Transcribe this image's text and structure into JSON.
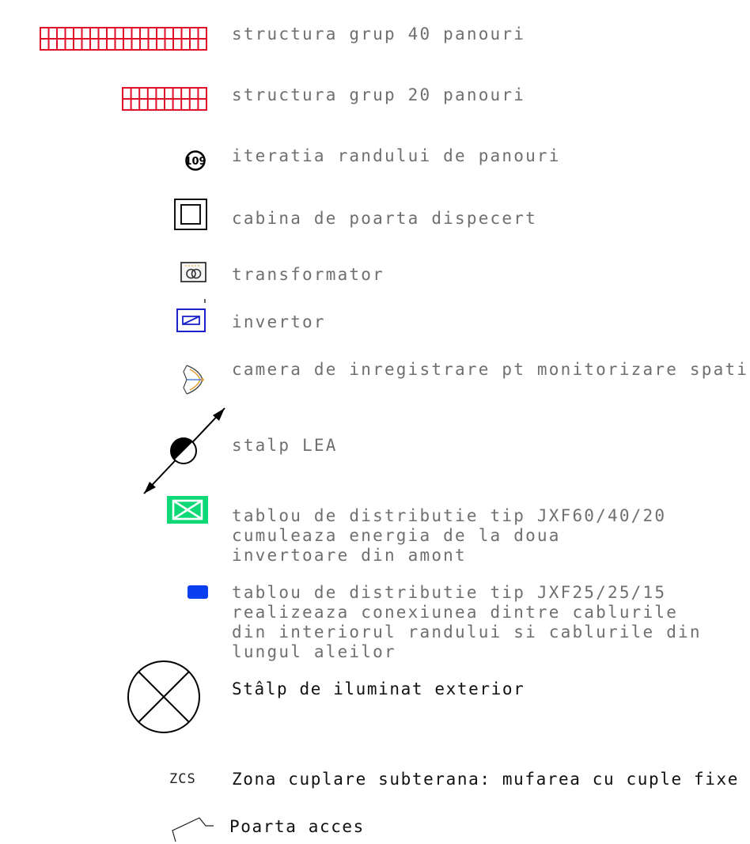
{
  "legend": {
    "struct40": "structura grup 40 panouri",
    "struct20": "structura grup 20 panouri",
    "iteration": "iteratia randului de panouri",
    "iteration_symbol": "109",
    "cabin": "cabina de poarta dispecert",
    "transformer": "transformator",
    "inverter": "invertor",
    "camera": "camera de inregistrare pt monitorizare spatiu",
    "pole": "stalp LEA",
    "dist_jxf60": "tablou de distributie tip JXF60/40/20\ncumuleaza energia de la doua\ninvertoare din amont",
    "dist_jxf25": "tablou de distributie tip JXF25/25/15\nrealizeaza conexiunea dintre cablurile\ndin interiorul randului si cablurile din\nlungul aleilor",
    "lighting_pole": "Stâlp de iluminat exterior",
    "zcs_abbr": "ZCS",
    "zcs": "Zona cuplare subterana: mufarea cu cuple fixe",
    "gate": "Poarta acces"
  },
  "colors": {
    "panel_red": "#e0102a",
    "inverter_blue": "#1a22c8",
    "dist_green": "#0fd877",
    "dist_blue": "#0a3ff0",
    "camera_orange": "#e39a2a"
  }
}
